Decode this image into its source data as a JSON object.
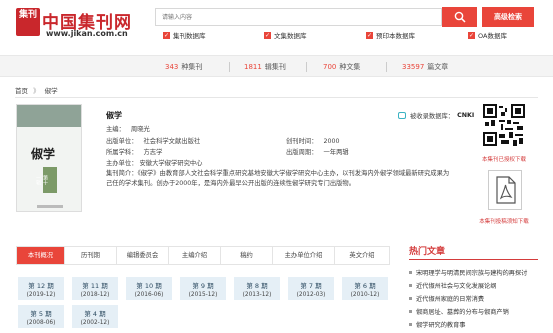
{
  "header": {
    "logo_mark": "集刊",
    "site_name": "中国集刊网",
    "site_url": "www.jikan.com.cn",
    "search_placeholder": "请输入内容",
    "advanced_search_label": "高级检索",
    "filters": [
      "集刊数据库",
      "文集数据库",
      "预印本数据库",
      "OA数据库"
    ]
  },
  "stats": [
    {
      "num": "343",
      "label": "种集刊"
    },
    {
      "num": "1811",
      "label": "辑集刊"
    },
    {
      "num": "700",
      "label": "种文集"
    },
    {
      "num": "33597",
      "label": "篇文章"
    }
  ],
  "breadcrumb": {
    "home": "首页",
    "separator": "》",
    "current": "俶学"
  },
  "journal": {
    "cover_title": "俶学",
    "cover_sub": "第十一辑",
    "name": "俶学",
    "chief_editor_label": "主编：",
    "chief_editor": "周晓光",
    "publisher_label": "出版单位：",
    "publisher": "社会科学文献出版社",
    "founded_label": "创刊时间：",
    "founded": "2000",
    "discipline_label": "所属学科：",
    "discipline": "方志学",
    "frequency_label": "出版周期：",
    "frequency": "一年两辑",
    "sponsor_label": "主办单位：",
    "sponsor": "安徽大学俶学研究中心",
    "intro_label": "集刊简介：",
    "intro": "《俶学》由教育部人文社会科学重点研究基地安徽大学俶学研究中心主办，以刊发海内外俶学领域最新研究成果为己任的学术集刊。创办于2000年，是海内外最早公开出版的连续性俶学研究专门出版物。",
    "indexed_label": "被收录数据库：",
    "indexed": "CNKI"
  },
  "right": {
    "qr_label": "本集刊已授权下载",
    "pdf_label": "本集刊投稿须知下载"
  },
  "tabs": [
    "本刊概况",
    "历刊期",
    "编辑委员会",
    "主编介绍",
    "稿约",
    "主办单位介绍",
    "英文介绍"
  ],
  "issues": [
    {
      "name": "第 12 期",
      "date": "(2019-12)"
    },
    {
      "name": "第 11 期",
      "date": "(2018-12)"
    },
    {
      "name": "第 10 期",
      "date": "(2016-06)"
    },
    {
      "name": "第 9 期",
      "date": "(2015-12)"
    },
    {
      "name": "第 8 期",
      "date": "(2013-12)"
    },
    {
      "name": "第 7 期",
      "date": "(2012-03)"
    },
    {
      "name": "第 6 期",
      "date": "(2010-12)"
    },
    {
      "name": "第 5 期",
      "date": "(2008-06)"
    },
    {
      "name": "第 4 期",
      "date": "(2002-12)"
    }
  ],
  "hot": {
    "title": "热门文章",
    "items": [
      "宋明理学与明清民间宗族与建构的再探讨",
      "近代俶州社会与文化发展论纲",
      "近代俶州家庭的日常消费",
      "俶商居址、墓葬的分布与俶商产销",
      "俶学研究的教育事"
    ]
  },
  "colors": {
    "accent": "#e9453a",
    "issue_bg": "#e5eff6"
  }
}
